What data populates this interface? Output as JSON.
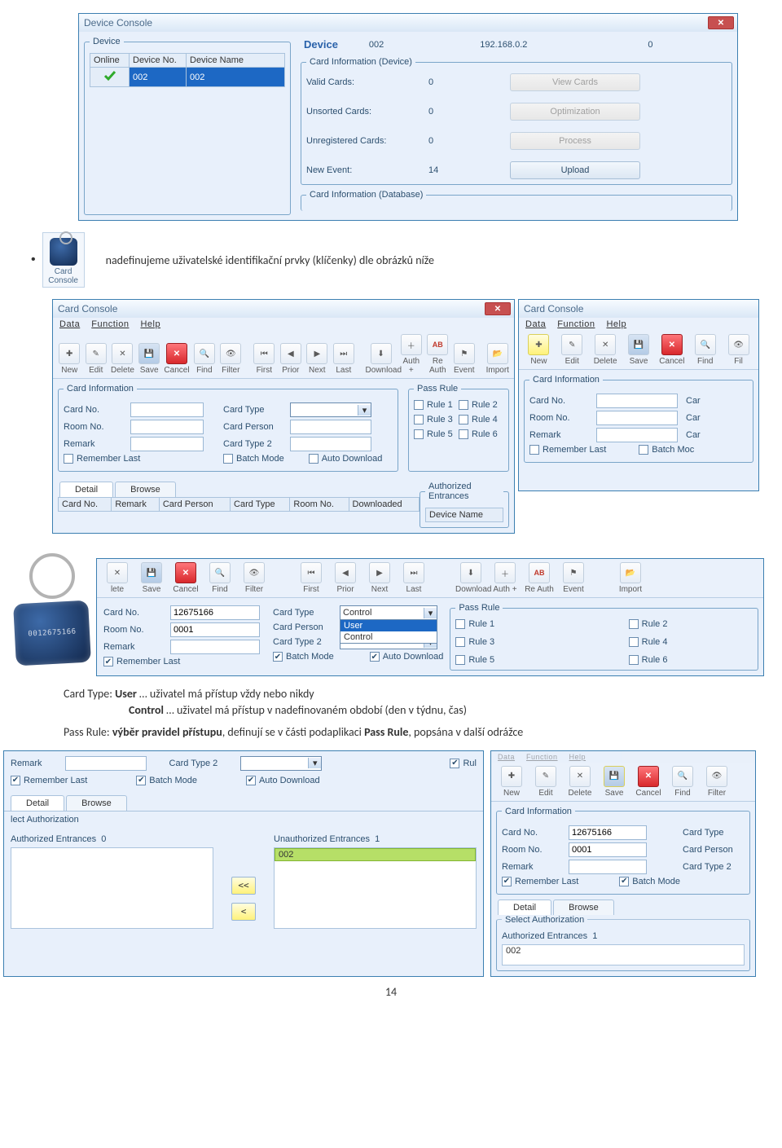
{
  "page_number": "14",
  "doc_text": {
    "bullet1": "nadefinujeme uživatelské identifikační prvky (klíčenky) dle obrázků níže",
    "card_type_line_pre": "Card Type: ",
    "card_type_user": "User",
    "card_type_user_rest": " … uživatel má přístup vždy nebo nikdy",
    "control_bold": "Control",
    "control_rest": " … uživatel má přístup v nadefinovaném období (den v týdnu, čas)",
    "passrule_pre": "Pass Rule: ",
    "passrule_bold1": "výběr pravidel přístupu",
    "passrule_mid": ", definují se v části podaplikaci ",
    "passrule_bold2": "Pass Rule",
    "passrule_rest": ", popsána v další odrážce"
  },
  "device_console": {
    "title": "Device Console",
    "device_group_label": "Device",
    "device_header_title": "Device",
    "device_id": "002",
    "device_ip": "192.168.0.2",
    "device_zero": "0",
    "grid": {
      "h1": "Online",
      "h2": "Device No.",
      "h3": "Device Name",
      "row_no": "002",
      "row_name": "002"
    },
    "ci_group": "Card Information (Device)",
    "valid_cards_l": "Valid Cards:",
    "valid_cards_v": "0",
    "view_cards_btn": "View Cards",
    "unsorted_l": "Unsorted Cards:",
    "unsorted_v": "0",
    "optimize_btn": "Optimization",
    "unreg_l": "Unregistered Cards:",
    "unreg_v": "0",
    "process_btn": "Process",
    "newev_l": "New Event:",
    "newev_v": "14",
    "upload_btn": "Upload",
    "db_group": "Card Information (Database)"
  },
  "card_console_icon_label": "Card Console",
  "card_console1": {
    "title": "Card Console",
    "menu": [
      "Data",
      "Function",
      "Help"
    ],
    "toolbar": [
      "New",
      "Edit",
      "Delete",
      "Save",
      "Cancel",
      "Find",
      "Filter",
      "",
      "First",
      "Prior",
      "Next",
      "Last",
      "",
      "Download",
      "Auth +",
      "Re Auth",
      "Event",
      "",
      "Import"
    ],
    "ci_group": "Card Information",
    "cardno": "Card No.",
    "roomno": "Room No.",
    "remark": "Remark",
    "cardtype": "Card Type",
    "cardperson": "Card Person",
    "cardtype2": "Card Type 2",
    "remember_last": "Remember Last",
    "batch_mode": "Batch Mode",
    "auto_download": "Auto Download",
    "pass_group": "Pass Rule",
    "rules": [
      "Rule 1",
      "Rule 2",
      "Rule 3",
      "Rule 4",
      "Rule 5",
      "Rule 6"
    ],
    "tabs": [
      "Detail",
      "Browse"
    ],
    "bgrid": [
      "Card No.",
      "Remark",
      "Card Person",
      "Card Type",
      "Room No.",
      "Downloaded"
    ],
    "ae_group": "Authorized Entrances",
    "ae_col": "Device Name"
  },
  "card_console2": {
    "title": "Card Console",
    "menu": [
      "Data",
      "Function",
      "Help"
    ],
    "toolbar": [
      "New",
      "Edit",
      "Delete",
      "Save",
      "Cancel",
      "Find",
      "Fil"
    ],
    "ci_group": "Card Information",
    "cardno": "Card No.",
    "roomno": "Room No.",
    "remark": "Remark",
    "batch_mode": "Batch Moc",
    "car": "Car",
    "remember_last": "Remember Last"
  },
  "card_console3": {
    "toolbar_a": [
      "lete",
      "Save",
      "Cancel",
      "Find",
      "Filter"
    ],
    "toolbar_b": [
      "First",
      "Prior",
      "Next",
      "Last"
    ],
    "toolbar_c": [
      "Download",
      "Auth +",
      "Re Auth",
      "Event",
      "Import"
    ],
    "cardno_l": "Card No.",
    "cardno_v": "12675166",
    "roomno_l": "Room No.",
    "roomno_v": "0001",
    "remark_l": "Remark",
    "cardtype_l": "Card Type",
    "cardperson_l": "Card Person",
    "cardtype2_l": "Card Type 2",
    "dd_selected": "Control",
    "dd_opts": [
      "User",
      "Control"
    ],
    "remember_last": "Remember Last",
    "batch_mode": "Batch Mode",
    "auto_download": "Auto Download",
    "pass_group": "Pass Rule",
    "rules": [
      "Rule 1",
      "Rule 2",
      "Rule 3",
      "Rule 4",
      "Rule 5",
      "Rule 6"
    ]
  },
  "card_console4": {
    "remark": "Remark",
    "cardtype2": "Card Type 2",
    "rul": "Rul",
    "remember_last": "Remember Last",
    "batch_mode": "Batch Mode",
    "auto_download": "Auto Download",
    "tabs": [
      "Detail",
      "Browse"
    ],
    "lect": "lect Authorization",
    "ae_l": "Authorized Entrances",
    "ae_v": "0",
    "ue_l": "Unauthorized Entrances",
    "ue_v": "1",
    "ue_item": "002",
    "btn_ll": "<<",
    "btn_l": "<"
  },
  "card_console5": {
    "toolbar": [
      "New",
      "Edit",
      "Delete",
      "Save",
      "Cancel",
      "Find",
      "Filter"
    ],
    "ci_group": "Card Information",
    "cardno_l": "Card No.",
    "cardno_v": "12675166",
    "cardtype": "Card Type",
    "roomno_l": "Room No.",
    "roomno_v": "0001",
    "cardperson": "Card Person",
    "cardtype2": "Card Type 2",
    "remark": "Remark",
    "remember_last": "Remember Last",
    "batch_mode": "Batch Mode",
    "tabs": [
      "Detail",
      "Browse"
    ],
    "sa": "Select Authorization",
    "ae_l": "Authorized Entrances",
    "ae_v": "1",
    "ae_item": "002"
  },
  "fob_serial": "0012675166"
}
